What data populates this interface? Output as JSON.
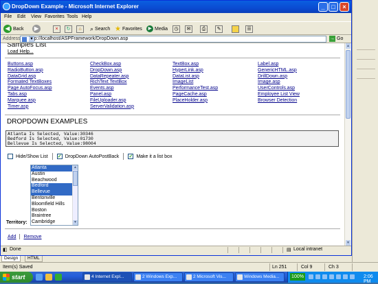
{
  "window": {
    "title": "DropDown Example - Microsoft Internet Explorer",
    "menu": [
      "File",
      "Edit",
      "View",
      "Favorites",
      "Tools",
      "Help"
    ],
    "toolbar": {
      "back": "Back",
      "search": "Search",
      "favorites": "Favorites",
      "media": "Media"
    },
    "address": {
      "label": "Address",
      "url": "http://localhost/ASPFramework/DropDown.asp",
      "go": "Go"
    }
  },
  "page": {
    "samples_heading": "Samples List",
    "load_help": "Load Help...",
    "links": [
      [
        "Buttons.asp",
        "RadioButton.asp",
        "DataGrid.asp",
        "Formated TextBoxes",
        "Page AutoFocus.asp",
        "Tabs.asp",
        "Marquee.asp",
        "Timer.asp"
      ],
      [
        "CheckBox.asp",
        "DropDown.asp",
        "DataRepeater.asp",
        "RichText TextBox",
        "Events.asp",
        "Panel.asp",
        "FileUploader.asp",
        "ServerValidation.asp"
      ],
      [
        "TextBox.asp",
        "HyperLink.asp",
        "DataList.asp",
        "ImageList",
        "PerformanceTest.asp",
        "PageCache.asp",
        "PlaceHolder.asp"
      ],
      [
        "Label.asp",
        "GenericHTML.asp",
        "DrillDown.asp",
        "Image.asp",
        "UserControls.asp",
        "Employee List View",
        "Browser Detection"
      ]
    ],
    "dropdown_heading": "DROPDOWN EXAMPLES",
    "selections": [
      "Atlanta Is Selected, Value:30346",
      "Bedford Is Selected, Value:01730",
      "Bellevue Is Selected, Value:98004"
    ],
    "options": [
      {
        "label": "Hide/Show List",
        "checked": false
      },
      {
        "label": "DropDown AutoPostBack",
        "checked": true
      },
      {
        "label": "Make it a list box",
        "checked": true
      }
    ],
    "listbox": [
      {
        "text": "Atlanta",
        "selected": true
      },
      {
        "text": "Austin",
        "selected": false
      },
      {
        "text": "Beachwood",
        "selected": false
      },
      {
        "text": "Bedford",
        "selected": true
      },
      {
        "text": "Bellevue",
        "selected": true
      },
      {
        "text": "Bentonville",
        "selected": false
      },
      {
        "text": "Bloomfield Hills",
        "selected": false
      },
      {
        "text": "Boston",
        "selected": false
      },
      {
        "text": "Braintree",
        "selected": false
      },
      {
        "text": "Cambridge",
        "selected": false
      }
    ],
    "territory_label": "Territory:",
    "add": "Add",
    "remove": "Remove"
  },
  "ie_status": {
    "left": "Done",
    "zone": "Local intranet"
  },
  "design_tabs": {
    "design": "Design",
    "html": "HTML"
  },
  "editor_status": {
    "saved": "Item(s) Saved",
    "ln": "Ln 251",
    "col": "Col 9",
    "ch": "Ch 3"
  },
  "taskbar": {
    "start": "start",
    "tasks": [
      "4 Internet Expl...",
      "2 Windows Exp...",
      "2 Microsoft Vis...",
      "Windows Media..."
    ],
    "tray_percent": "100%",
    "clock": "2:06 PM"
  }
}
